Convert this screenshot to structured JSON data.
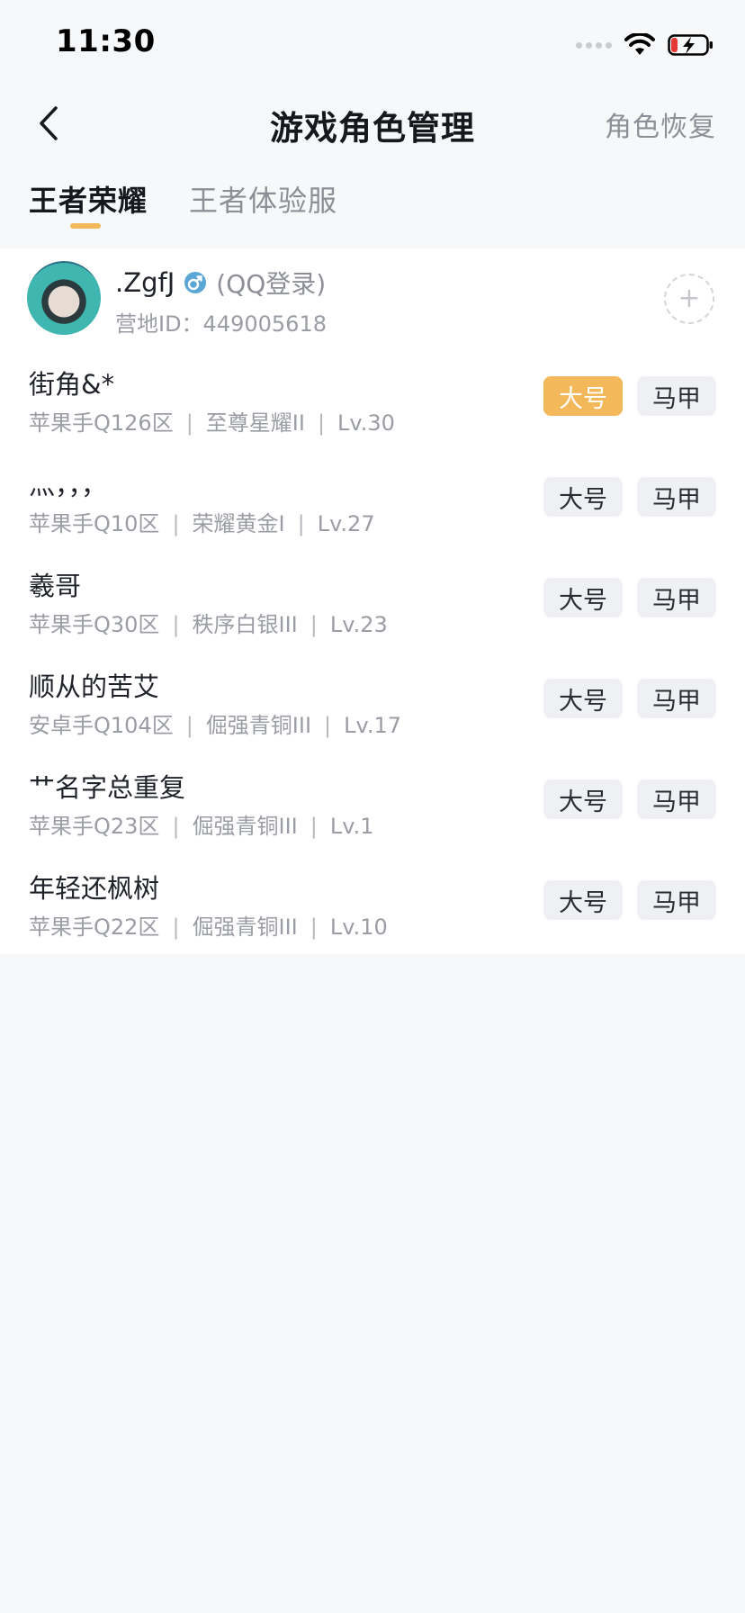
{
  "status_bar": {
    "time": "11:30"
  },
  "nav": {
    "title": "游戏角色管理",
    "action": "角色恢复"
  },
  "tabs": [
    {
      "label": "王者荣耀",
      "active": true
    },
    {
      "label": "王者体验服",
      "active": false
    }
  ],
  "account": {
    "name": ".ZgfJ",
    "gender_icon": "male-icon",
    "login_type": "(QQ登录)",
    "id_text": "营地ID：449005618"
  },
  "roles": [
    {
      "name": "街角&*",
      "server": "苹果手Q126区",
      "rank": "至尊星耀II",
      "level": "Lv.30",
      "main_label": "大号",
      "alt_label": "马甲",
      "is_main": true
    },
    {
      "name": "灬，，，",
      "server": "苹果手Q10区",
      "rank": "荣耀黄金I",
      "level": "Lv.27",
      "main_label": "大号",
      "alt_label": "马甲",
      "is_main": false
    },
    {
      "name": "羲哥",
      "server": "苹果手Q30区",
      "rank": "秩序白银III",
      "level": "Lv.23",
      "main_label": "大号",
      "alt_label": "马甲",
      "is_main": false
    },
    {
      "name": "顺从的苦艾",
      "server": "安卓手Q104区",
      "rank": "倔强青铜III",
      "level": "Lv.17",
      "main_label": "大号",
      "alt_label": "马甲",
      "is_main": false
    },
    {
      "name": "艹名字总重复",
      "server": "苹果手Q23区",
      "rank": "倔强青铜III",
      "level": "Lv.1",
      "main_label": "大号",
      "alt_label": "马甲",
      "is_main": false
    },
    {
      "name": "年轻还枫树",
      "server": "苹果手Q22区",
      "rank": "倔强青铜III",
      "level": "Lv.10",
      "main_label": "大号",
      "alt_label": "马甲",
      "is_main": false
    }
  ],
  "colors": {
    "accent": "#f2b85a",
    "background": "#f7f8fa",
    "muted": "#9a9da3"
  }
}
